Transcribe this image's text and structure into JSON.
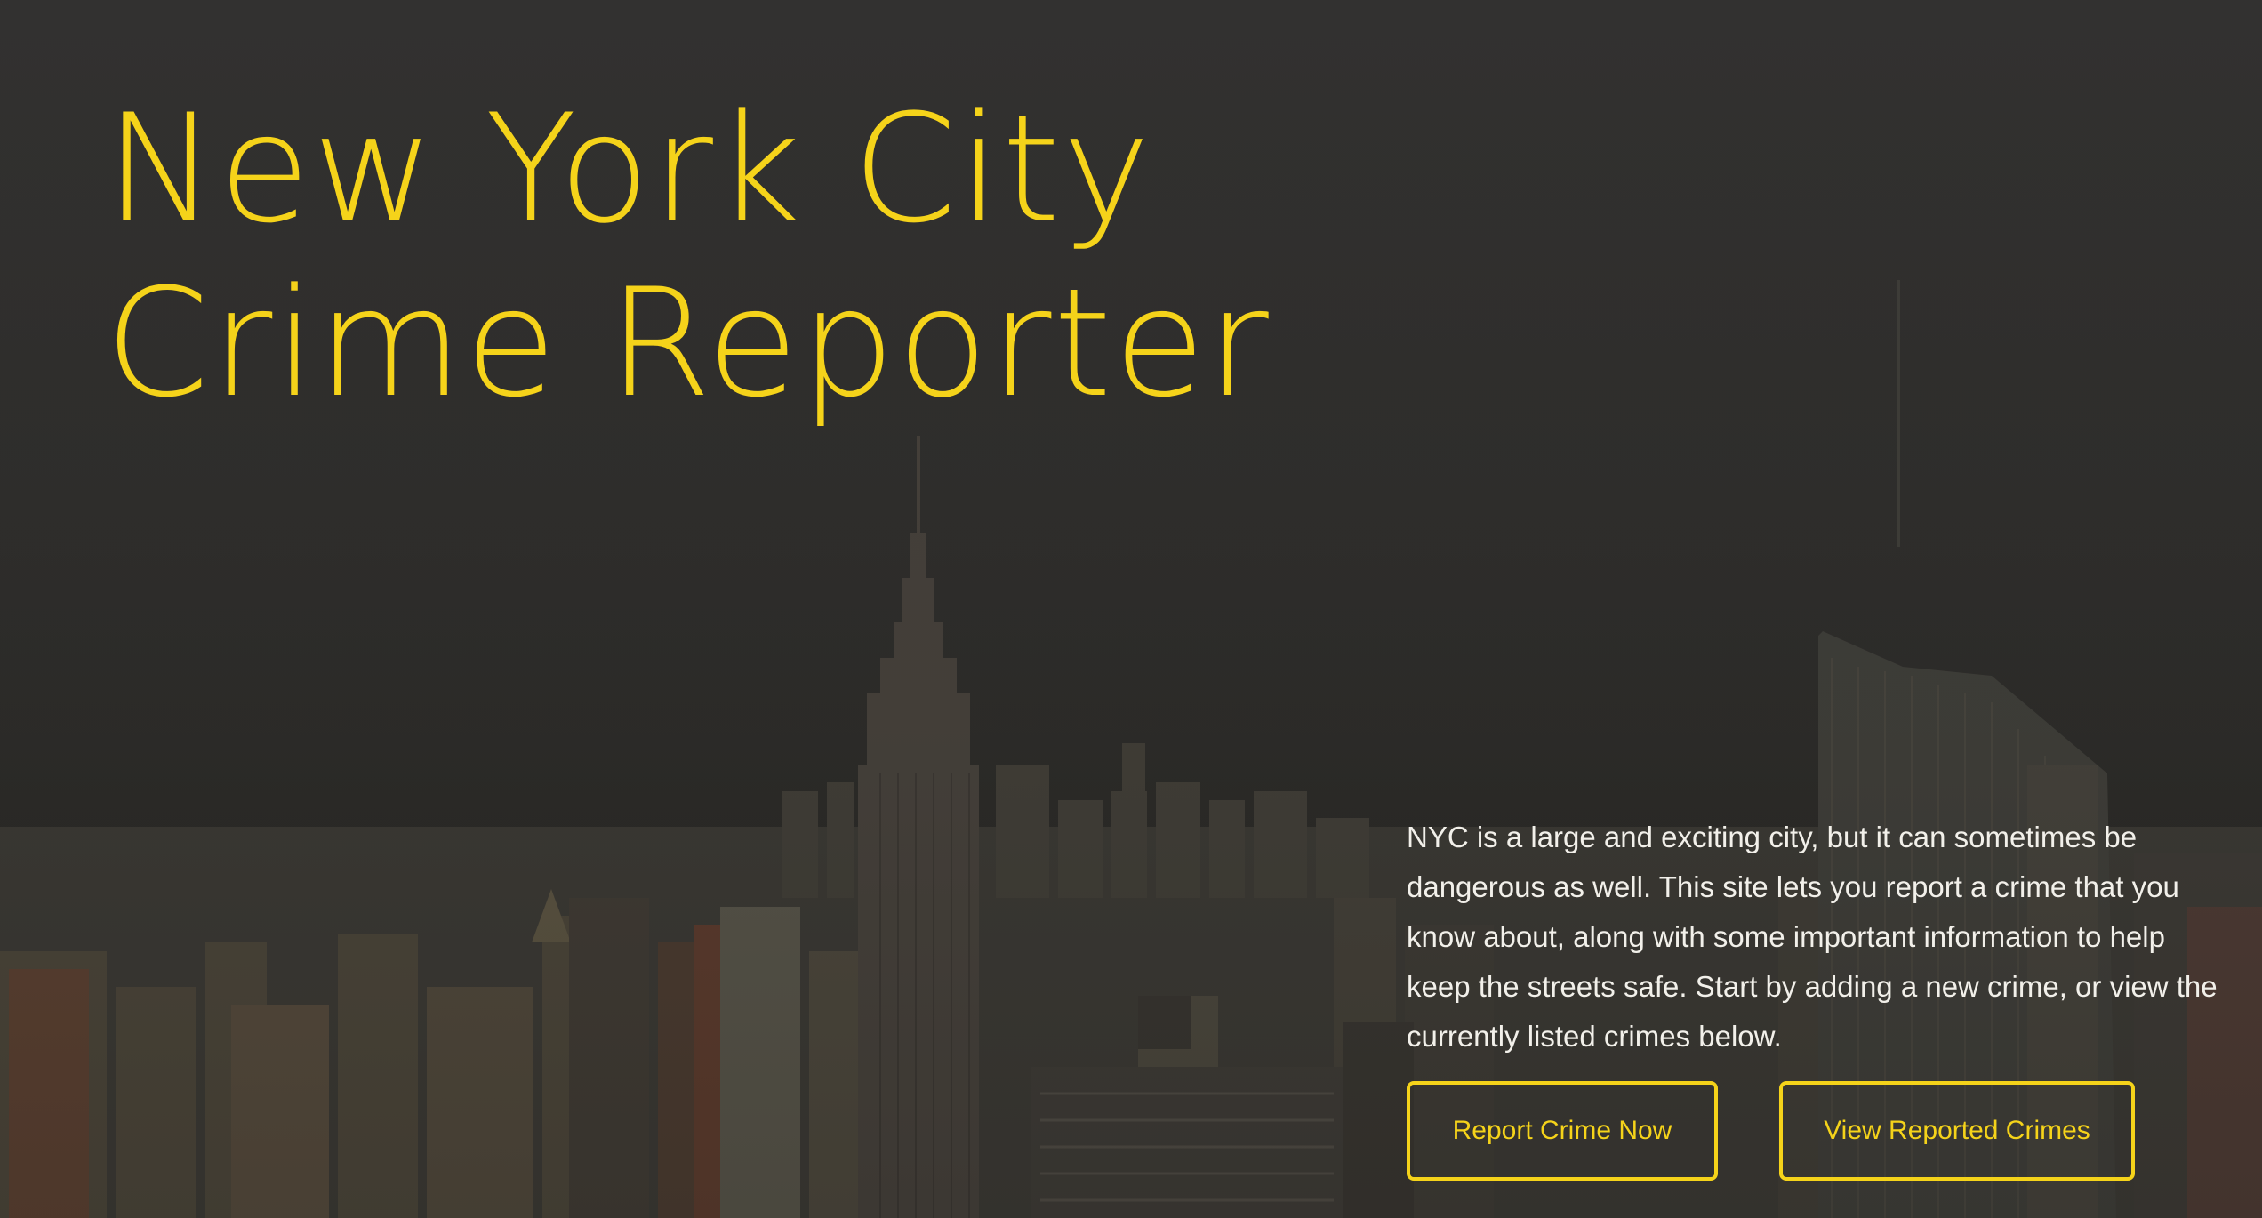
{
  "hero": {
    "title_line1": "New York City",
    "title_line2": "Crime Reporter",
    "description": "NYC is a large and exciting city, but it can sometimes be dangerous as well. This site lets you report a crime that you know about, along with some important information to help keep the streets safe. Start by adding a new crime, or view the currently listed crimes below.",
    "buttons": {
      "report_label": "Report Crime Now",
      "view_label": "View Reported Crimes"
    }
  },
  "colors": {
    "accent": "#f5d31a",
    "background": "#2e2d2b",
    "text": "#f2f0ea"
  }
}
